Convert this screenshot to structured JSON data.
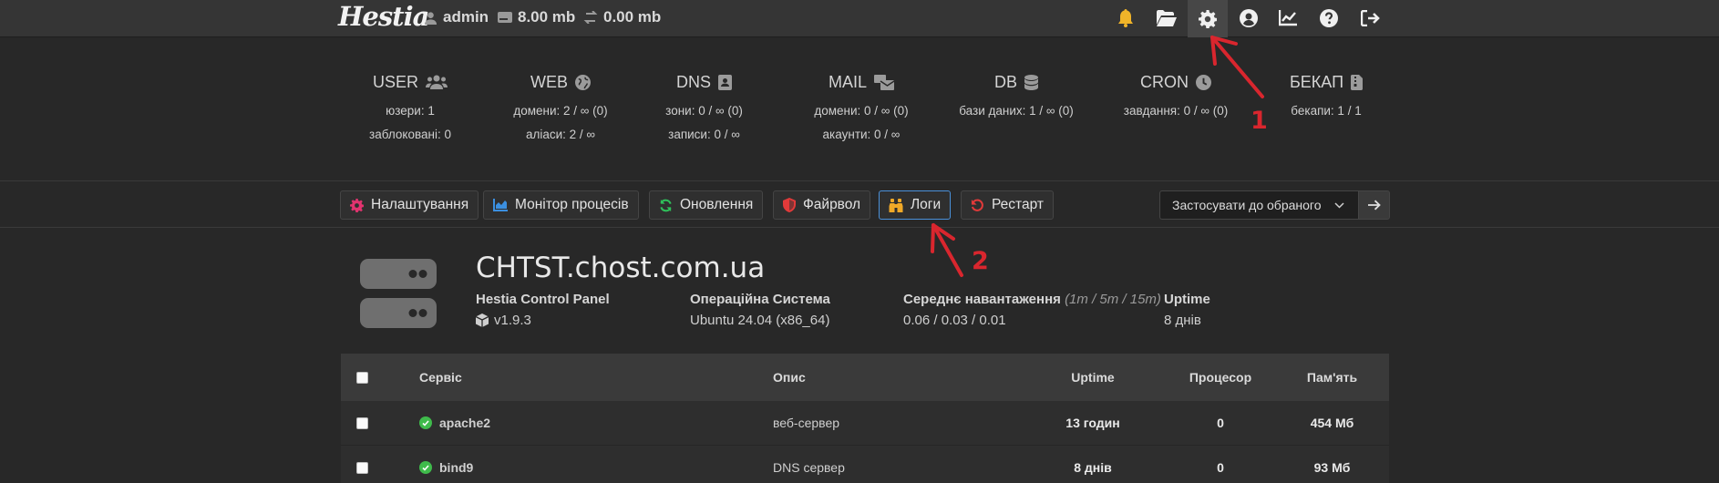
{
  "topbar": {
    "logo": "Hestia",
    "user": "admin",
    "disk": "8.00 mb",
    "bandwidth": "0.00 mb",
    "icons": [
      "bell-icon",
      "folder-open-icon",
      "gear-icon",
      "user-circle-icon",
      "chart-line-icon",
      "question-circle-icon",
      "logout-icon"
    ]
  },
  "stats": [
    {
      "title": "USER",
      "icon": "users-icon",
      "lines": [
        "юзери: 1",
        "заблоковані: 0"
      ]
    },
    {
      "title": "WEB",
      "icon": "globe-icon",
      "lines": [
        "домени: 2 / ∞ (0)",
        "аліаси: 2 / ∞"
      ]
    },
    {
      "title": "DNS",
      "icon": "address-book-icon",
      "lines": [
        "зони: 0 / ∞ (0)",
        "записи: 0 / ∞"
      ]
    },
    {
      "title": "MAIL",
      "icon": "mail-bulk-icon",
      "lines": [
        "домени: 0 / ∞ (0)",
        "акаунти: 0 / ∞"
      ]
    },
    {
      "title": "DB",
      "icon": "database-icon",
      "lines": [
        "бази даних: 1 / ∞ (0)"
      ]
    },
    {
      "title": "CRON",
      "icon": "clock-icon",
      "lines": [
        "завдання: 0 / ∞ (0)"
      ]
    },
    {
      "title": "БЕКАП",
      "icon": "file-zip-icon",
      "lines": [
        "бекапи: 1 / 1"
      ]
    }
  ],
  "toolbar": {
    "buttons": [
      {
        "label": "Налаштування",
        "icon": "gear-icon",
        "color": "#e2336f"
      },
      {
        "label": "Монітор процесів",
        "icon": "chart-area-icon",
        "color": "#3b8fe0"
      },
      {
        "label": "Оновлення",
        "icon": "refresh-icon",
        "color": "#2fbf5a"
      },
      {
        "label": "Файрвол",
        "icon": "shield-icon",
        "color": "#e23a3a"
      },
      {
        "label": "Логи",
        "icon": "binoculars-icon",
        "color": "#f0a927"
      },
      {
        "label": "Рестарт",
        "icon": "undo-icon",
        "color": "#e23a3a"
      }
    ],
    "select_label": "Застосувати до обраного"
  },
  "server": {
    "hostname": "CHTST.chost.com.ua",
    "panel_label": "Hestia Control Panel",
    "panel_version": "v1.9.3",
    "os_label": "Операційна Система",
    "os_value": "Ubuntu 24.04 (x86_64)",
    "load_label": "Середнє навантаження",
    "load_hint": "(1m / 5m / 15m)",
    "load_value": "0.06 / 0.03 / 0.01",
    "uptime_label": "Uptime",
    "uptime_value": "8 днів"
  },
  "table": {
    "headers": {
      "service": "Сервіс",
      "description": "Опис",
      "uptime": "Uptime",
      "cpu": "Процесор",
      "memory": "Пам'ять"
    },
    "rows": [
      {
        "service": "apache2",
        "description": "веб-сервер",
        "uptime": "13 годин",
        "cpu": "0",
        "memory": "454 Мб"
      },
      {
        "service": "bind9",
        "description": "DNS сервер",
        "uptime": "8 днів",
        "cpu": "0",
        "memory": "93 Мб"
      }
    ]
  },
  "annotations": {
    "first": "1",
    "second": "2",
    "color": "#d9262e"
  }
}
